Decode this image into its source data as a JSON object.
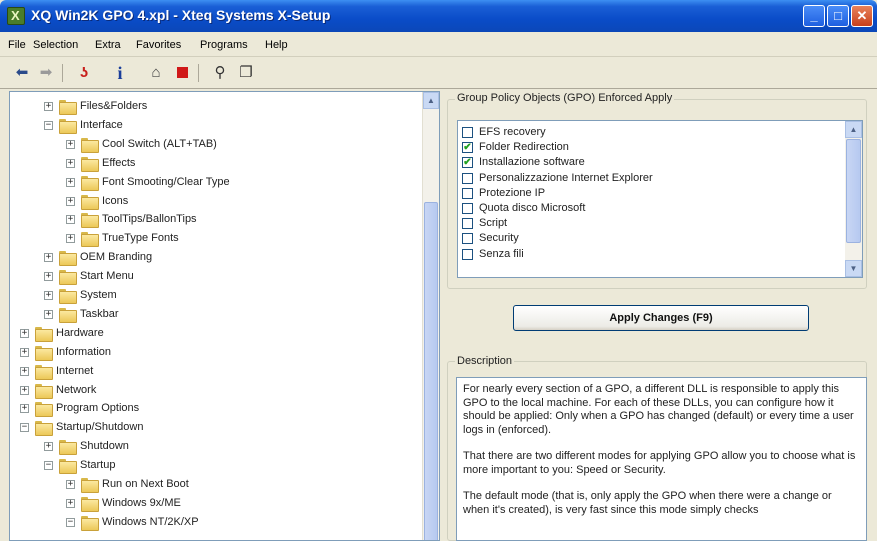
{
  "window": {
    "title": "XQ Win2K GPO 4.xpl - Xteq Systems X-Setup",
    "icon": "xsetup-app-icon"
  },
  "menu": [
    "File",
    "Selection",
    "Extra",
    "Favorites",
    "Programs",
    "Help"
  ],
  "toolbar": [
    "back-arrow-icon",
    "forward-arrow-icon",
    "wizard-icon",
    "info-icon",
    "lock-icon",
    "stop-icon",
    "search-icon",
    "window-icon"
  ],
  "tree": [
    {
      "label": "Files&Folders",
      "level": 2,
      "expanded": false
    },
    {
      "label": "Interface",
      "level": 2,
      "expanded": true
    },
    {
      "label": "Cool Switch (ALT+TAB)",
      "level": 3,
      "expanded": false
    },
    {
      "label": "Effects",
      "level": 3,
      "expanded": false
    },
    {
      "label": "Font Smooting/Clear Type",
      "level": 3,
      "expanded": false
    },
    {
      "label": "Icons",
      "level": 3,
      "expanded": false
    },
    {
      "label": "ToolTips/BallonTips",
      "level": 3,
      "expanded": false
    },
    {
      "label": "TrueType Fonts",
      "level": 3,
      "expanded": false
    },
    {
      "label": "OEM Branding",
      "level": 2,
      "expanded": false
    },
    {
      "label": "Start Menu",
      "level": 2,
      "expanded": false
    },
    {
      "label": "System",
      "level": 2,
      "expanded": false
    },
    {
      "label": "Taskbar",
      "level": 2,
      "expanded": false
    },
    {
      "label": "Hardware",
      "level": 1,
      "expanded": false
    },
    {
      "label": "Information",
      "level": 1,
      "expanded": false
    },
    {
      "label": "Internet",
      "level": 1,
      "expanded": false
    },
    {
      "label": "Network",
      "level": 1,
      "expanded": false
    },
    {
      "label": "Program Options",
      "level": 1,
      "expanded": false
    },
    {
      "label": "Startup/Shutdown",
      "level": 1,
      "expanded": true
    },
    {
      "label": "Shutdown",
      "level": 2,
      "expanded": false
    },
    {
      "label": "Startup",
      "level": 2,
      "expanded": true
    },
    {
      "label": "Run on Next Boot",
      "level": 3,
      "expanded": false
    },
    {
      "label": "Windows 9x/ME",
      "level": 3,
      "expanded": false
    },
    {
      "label": "Windows NT/2K/XP",
      "level": 3,
      "expanded": true
    }
  ],
  "gpo": {
    "title": "Group Policy Objects (GPO) Enforced Apply",
    "items": [
      {
        "label": "EFS recovery",
        "checked": false
      },
      {
        "label": "Folder Redirection",
        "checked": true
      },
      {
        "label": "Installazione software",
        "checked": true
      },
      {
        "label": "Personalizzazione Internet Explorer",
        "checked": false
      },
      {
        "label": "Protezione IP",
        "checked": false
      },
      {
        "label": "Quota disco Microsoft",
        "checked": false
      },
      {
        "label": "Script",
        "checked": false
      },
      {
        "label": "Security",
        "checked": false
      },
      {
        "label": "Senza fili",
        "checked": false
      }
    ]
  },
  "apply_button": "Apply Changes (F9)",
  "description": {
    "title": "Description",
    "paragraphs": [
      "For nearly every section of a GPO, a different DLL is responsible to apply this GPO to the local machine. For each of these DLLs, you can configure how it should be applied: Only when a GPO has changed (default) or every time a user logs in (enforced).",
      "That there are two different modes for applying GPO allow you to choose what is more important to you: Speed or Security.",
      "The default mode (that is, only apply the GPO when there were a change or when it's created), is very fast since this mode simply checks"
    ]
  }
}
